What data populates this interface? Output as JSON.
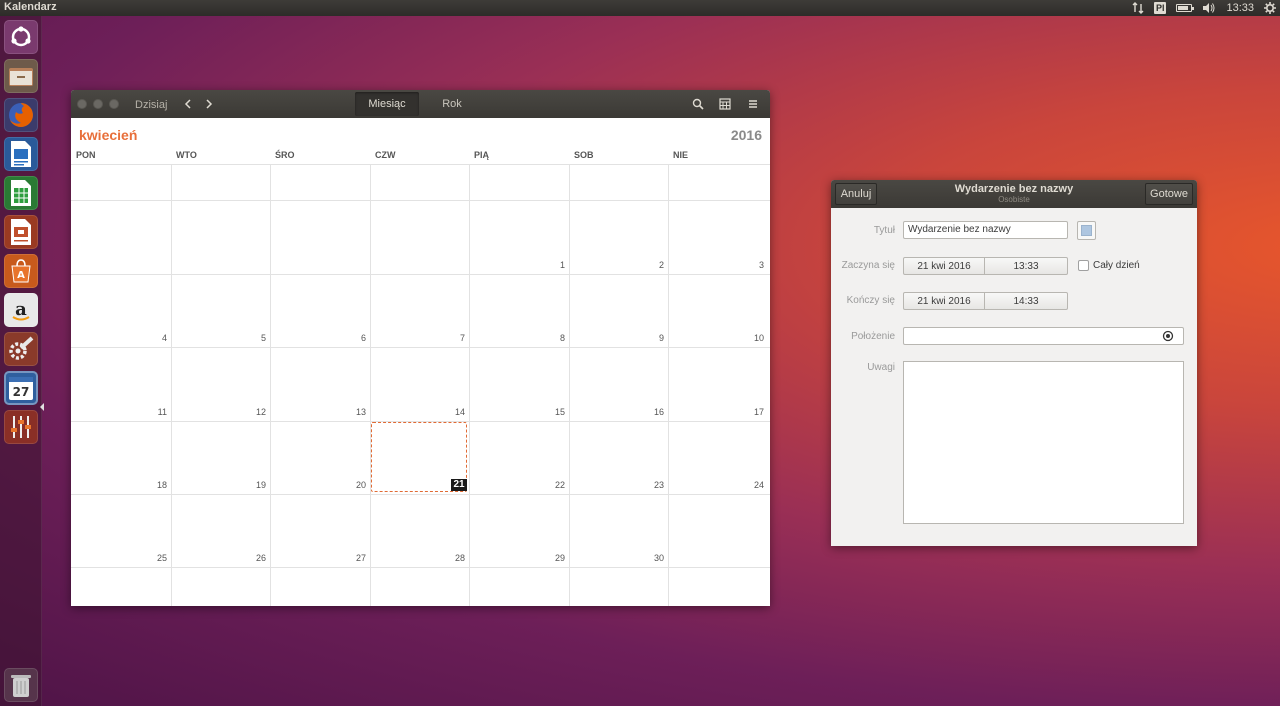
{
  "top_panel": {
    "app_title": "Kalendarz",
    "keyboard_layout": "Pl",
    "clock": "13:33"
  },
  "launcher": {
    "items": [
      {
        "name": "dash-home-icon",
        "color": "#7a3a6e"
      },
      {
        "name": "files-icon",
        "color": "#b8805a"
      },
      {
        "name": "firefox-icon",
        "color": "#e66000"
      },
      {
        "name": "libreoffice-writer-icon",
        "color": "#2a6fbf"
      },
      {
        "name": "libreoffice-calc-icon",
        "color": "#2e9e3e"
      },
      {
        "name": "libreoffice-impress-icon",
        "color": "#c0502d"
      },
      {
        "name": "ubuntu-software-icon",
        "color": "#e8742c"
      },
      {
        "name": "amazon-icon",
        "color": "#f0f0f0"
      },
      {
        "name": "system-settings-icon",
        "color": "#c54a2a"
      },
      {
        "name": "calendar-app-icon",
        "color": "#3b6fb4",
        "label": "27"
      },
      {
        "name": "system-equalizer-icon",
        "color": "#c94a34"
      }
    ],
    "trash_icon": "trash-icon"
  },
  "calendar": {
    "header": {
      "today_label": "Dzisiaj",
      "views": [
        {
          "label": "Miesiąc",
          "active": true
        },
        {
          "label": "Rok",
          "active": false
        }
      ]
    },
    "month_label": "kwiecień",
    "year_label": "2016",
    "weekdays": [
      "PON",
      "WTO",
      "ŚRO",
      "CZW",
      "PIĄ",
      "SOB",
      "NIE"
    ],
    "weeks": [
      [
        "",
        "",
        "",
        "",
        "1",
        "2",
        "3"
      ],
      [
        "4",
        "5",
        "6",
        "7",
        "8",
        "9",
        "10"
      ],
      [
        "11",
        "12",
        "13",
        "14",
        "15",
        "16",
        "17"
      ],
      [
        "18",
        "19",
        "20",
        "21",
        "22",
        "23",
        "24"
      ],
      [
        "25",
        "26",
        "27",
        "28",
        "29",
        "30",
        ""
      ]
    ],
    "today": "21",
    "accent_color": "#e86f3a"
  },
  "event_dialog": {
    "cancel_label": "Anuluj",
    "done_label": "Gotowe",
    "title": "Wydarzenie bez nazwy",
    "subtitle": "Osobiste",
    "fields": {
      "title_label": "Tytuł",
      "title_value": "Wydarzenie bez nazwy",
      "starts_label": "Zaczyna się",
      "start_date": "21 kwi 2016",
      "start_time": "13:33",
      "all_day_label": "Cały dzień",
      "all_day_checked": false,
      "ends_label": "Kończy się",
      "end_date": "21 kwi 2016",
      "end_time": "14:33",
      "location_label": "Położenie",
      "location_value": "",
      "notes_label": "Uwagi",
      "notes_value": ""
    },
    "calendar_color": "#aec6e0"
  }
}
